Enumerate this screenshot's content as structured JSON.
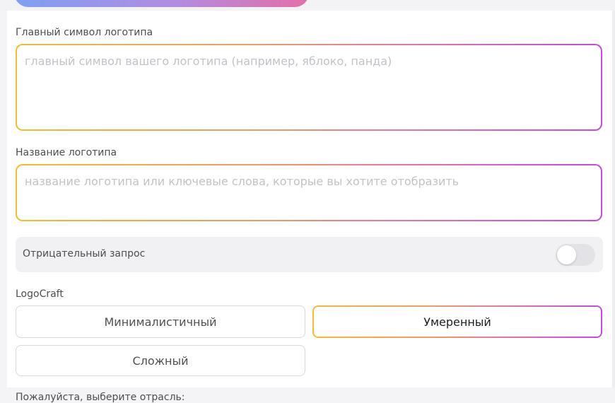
{
  "form": {
    "symbol_label": "Главный символ логотипа",
    "symbol_placeholder": "главный символ вашего логотипа (например, яблоко, панда)",
    "symbol_value": "",
    "name_label": "Название логотипа",
    "name_placeholder": "название логотипа или ключевые слова, которые вы хотите отобразить",
    "name_value": "",
    "negative_prompt_label": "Отрицательный запрос",
    "negative_prompt_enabled": false,
    "style_group_label": "LogoCraft",
    "style_options": [
      "Минималистичный",
      "Умеренный",
      "Сложный"
    ],
    "style_selected": "Умеренный",
    "industry_label": "Пожалуйста, выберите отрасль:"
  },
  "colors": {
    "gradient_start": "#f5bc2e",
    "gradient_end": "#c64ae6",
    "top_button_gradient": [
      "#7fa0f2",
      "#e46ea8"
    ]
  }
}
